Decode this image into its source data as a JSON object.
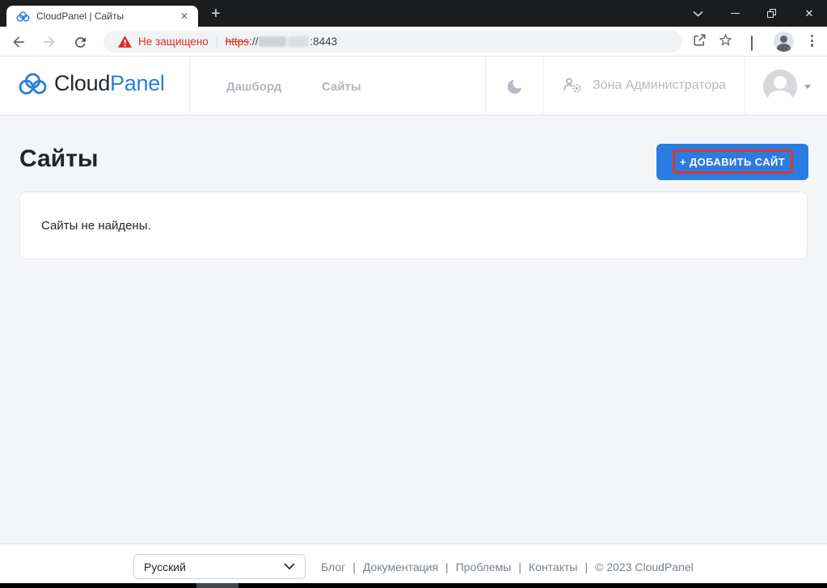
{
  "window": {
    "tab_title": "CloudPanel | Сайты",
    "glyphs": {
      "new_tab": "+",
      "tab_close": "✕",
      "close": "✕"
    }
  },
  "address_bar": {
    "warning_text": "Не защищено",
    "scheme": "https",
    "scheme_suffix": "://",
    "port": ":8443"
  },
  "app_header": {
    "brand_cloud": "Cloud",
    "brand_panel": "Panel",
    "nav": [
      {
        "label": "Дашборд"
      },
      {
        "label": "Сайты"
      }
    ],
    "admin_zone_label": "Зона Администратора"
  },
  "main": {
    "page_title": "Сайты",
    "add_site_button": "+ ДОБАВИТЬ САЙТ",
    "empty_message": "Сайты не найдены."
  },
  "footer": {
    "language_select": "Русский",
    "links": [
      {
        "label": "Блог"
      },
      {
        "label": "Документация"
      },
      {
        "label": "Проблемы"
      },
      {
        "label": "Контакты"
      }
    ],
    "separator": "|",
    "copyright": "© 2023  CloudPanel"
  },
  "colors": {
    "accent_blue": "#2b7ce2",
    "brand_blue": "#2b7de1",
    "annotation_red": "#df372e",
    "warning_red": "#d93025"
  }
}
